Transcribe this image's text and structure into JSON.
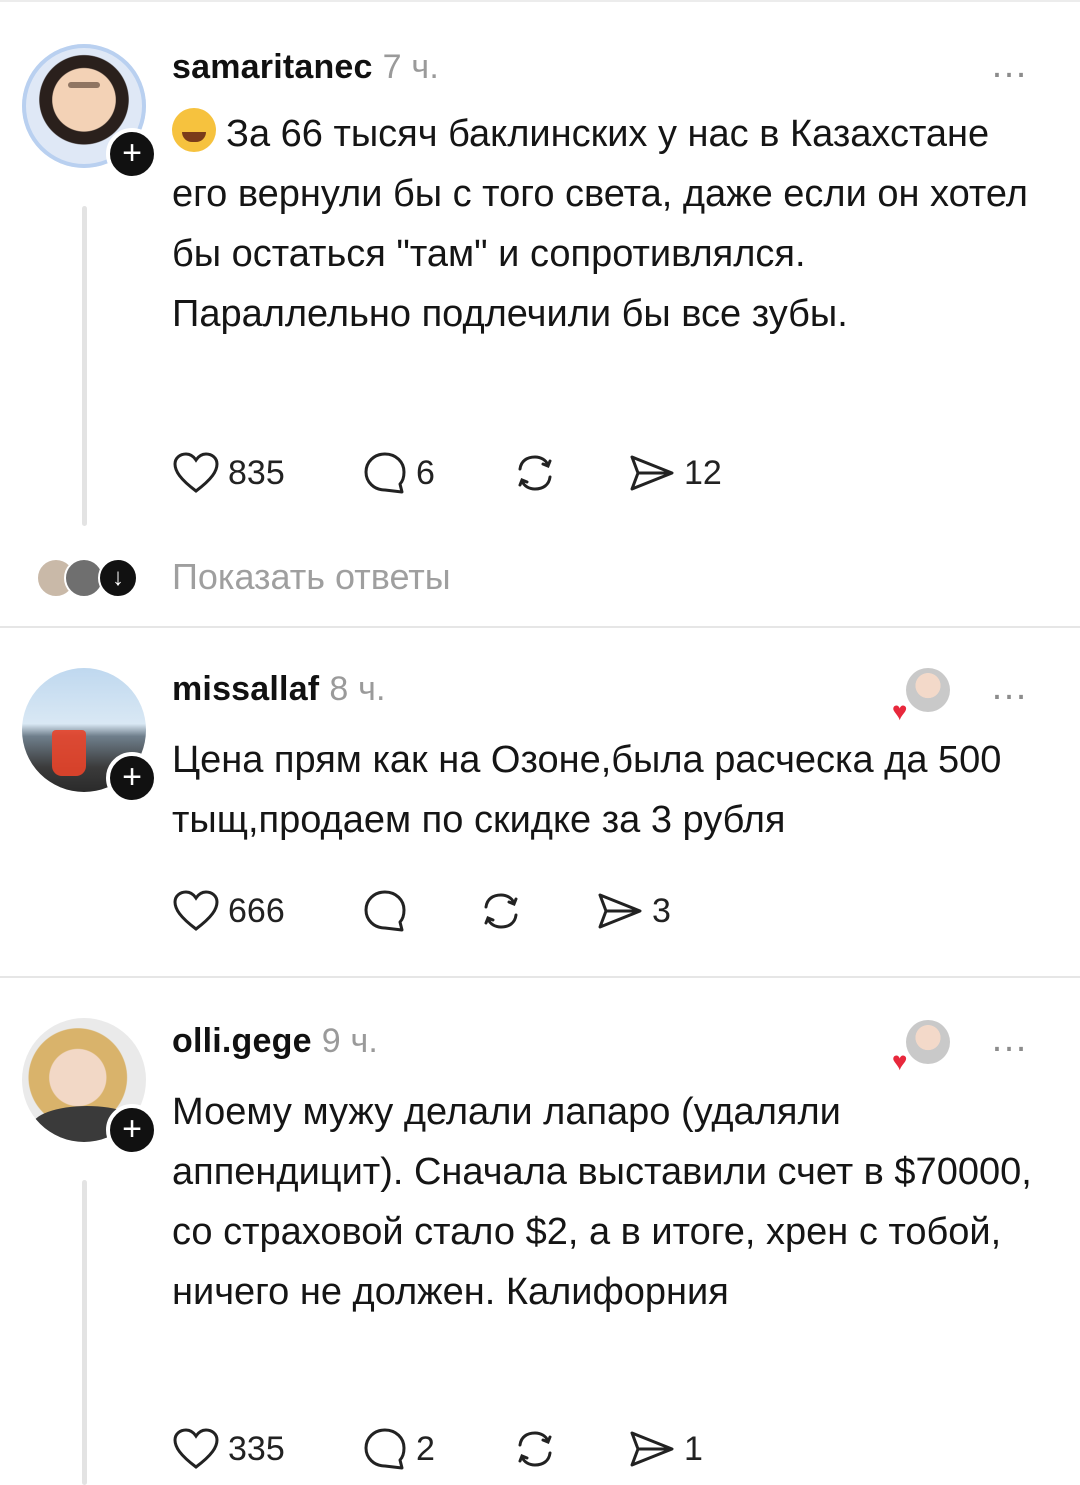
{
  "posts": [
    {
      "username": "samaritanec",
      "time": "7 ч.",
      "text": "За 66 тысяч баклинских у нас в Казахстане его вернули бы с того света, даже если он хотел бы остаться \"там\" и сопротивлялся. Параллельно подлечили бы все зубы.",
      "likes": "835",
      "comments": "6",
      "reposts": "",
      "shares": "12",
      "show_replies": "Показать ответы"
    },
    {
      "username": "missallaf",
      "time": "8 ч.",
      "text": "Цена прям как на Озоне,была расческа да 500 тыщ,продаем по скидке за 3 рубля",
      "likes": "666",
      "comments": "",
      "reposts": "",
      "shares": "3"
    },
    {
      "username": "olli.gege",
      "time": "9 ч.",
      "text": "Моему мужу делали лапаро (удаляли аппендицит). Сначала выставили счет в $70000, со страховой стало $2, а в итоге, хрен с тобой, ничего не должен. Калифорния",
      "likes": "335",
      "comments": "2",
      "reposts": "",
      "shares": "1"
    }
  ],
  "icons": {
    "more": "…",
    "plus": "+",
    "heart_badge": "♥",
    "down": "↓"
  },
  "colors": {
    "heart_badge": "#e8283c",
    "muted_text": "#9a9a9a",
    "divider": "#e6e6e6"
  }
}
